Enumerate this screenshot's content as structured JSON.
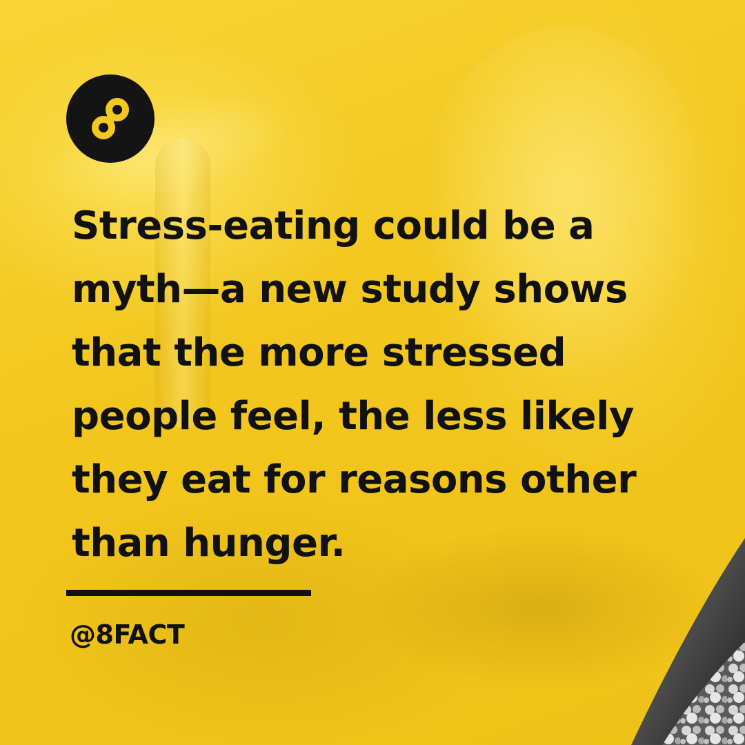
{
  "brand": {
    "logo_icon": "infinity-eight-icon",
    "logo_bg_color": "#141414",
    "logo_fg_color": "#f4c91f"
  },
  "headline": {
    "lines": [
      "Stress-eating could be a",
      "myth—a new study shows",
      "that the more stressed",
      "people feel, the less likely",
      "they eat for reasons other",
      "than hunger."
    ]
  },
  "handle": "@8FACT",
  "colors": {
    "background": "#f4c91f",
    "text": "#111111"
  }
}
